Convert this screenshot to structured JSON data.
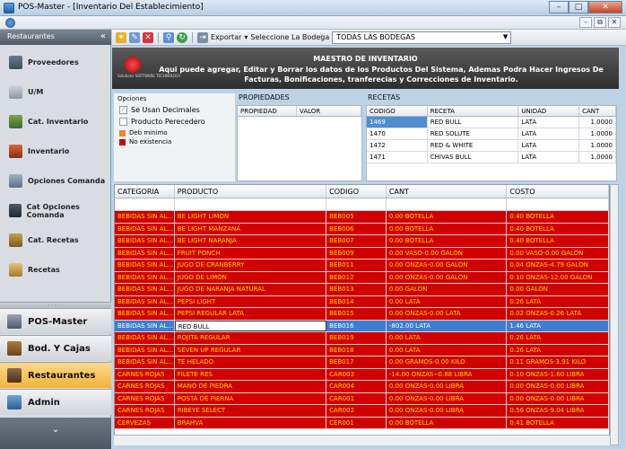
{
  "window": {
    "title": "POS-Master - [Inventario Del Establecimiento]"
  },
  "sidebar": {
    "header": "Restaurantes",
    "collapse": "«",
    "items": [
      {
        "label": "Proveedores",
        "icon": "truck-icon"
      },
      {
        "label": "U/M",
        "icon": "scale-icon"
      },
      {
        "label": "Cat. Inventario",
        "icon": "category-icon"
      },
      {
        "label": "Inventario",
        "icon": "inventory-icon"
      },
      {
        "label": "Opciones Comanda",
        "icon": "options-icon"
      },
      {
        "label": "Cat Opciones Comanda",
        "icon": "catalog-icon"
      },
      {
        "label": "Cat. Recetas",
        "icon": "recipes-cat-icon"
      },
      {
        "label": "Recetas",
        "icon": "recipe-icon"
      }
    ],
    "nav": [
      {
        "label": "POS-Master",
        "icon": "pos-icon",
        "active": false
      },
      {
        "label": "Bod. Y Cajas",
        "icon": "warehouse-icon",
        "active": false
      },
      {
        "label": "Restaurantes",
        "icon": "restaurant-icon",
        "active": true
      },
      {
        "label": "Admin",
        "icon": "admin-icon",
        "active": false
      }
    ],
    "footer": "⌄"
  },
  "toolbar": {
    "export_label": "Exportar",
    "select_label": "Seleccione La Bodega",
    "bodega_value": "TODAS LAS BODEGAS"
  },
  "banner": {
    "title": "MAESTRO DE INVENTARIO",
    "description": "Aqui puede agregar, Editar y Borrar los datos de los Productos Del Sistema, Ademas Podra Hacer Ingresos De Facturas, Bonificaciones, tranferecias y Correcciones de Inventario.",
    "logo_text": "Solutions SOFTWARE TECHNOLOGY"
  },
  "options": {
    "title": "Opciones",
    "chk1": "Se Usan Decimales",
    "chk2": "Producto Perecedero",
    "legend1": "Deb minimo",
    "legend2": "No existencia",
    "colors": {
      "min": "#e8892a",
      "none": "#d10000"
    }
  },
  "propiedades": {
    "title": "PROPIEDADES",
    "headers": [
      "PROPIEDAD",
      "VALOR"
    ]
  },
  "recetas": {
    "title": "RECETAS",
    "headers": [
      "CODIGO",
      "RECETA",
      "UNIDAD",
      "CANT"
    ],
    "rows": [
      [
        "1469",
        "RED BULL",
        "LATA",
        "1.0000"
      ],
      [
        "1470",
        "RED SOLUTE",
        "LATA",
        "1.0000"
      ],
      [
        "1472",
        "RED & WHITE",
        "LATA",
        "1.0000"
      ],
      [
        "1471",
        "CHIVAS BULL",
        "LATA",
        "1.0000"
      ]
    ]
  },
  "main": {
    "headers": [
      "CATEGORIA",
      "PRODUCTO",
      "CODIGO",
      "CANT",
      "COSTO"
    ],
    "rows": [
      [
        "BEBIDAS SIN AL...",
        "BE LIGHT LIMON",
        "BEB005",
        "0.00 BOTELLA",
        "0.40 BOTELLA"
      ],
      [
        "BEBIDAS SIN AL...",
        "BE LIGHT MANZANA",
        "BEB006",
        "0.00 BOTELLA",
        "0.40 BOTELLA"
      ],
      [
        "BEBIDAS SIN AL...",
        "BE LIGHT NARANJA",
        "BEB007",
        "0.00 BOTELLA",
        "0.40 BOTELLA"
      ],
      [
        "BEBIDAS SIN AL...",
        "FRUIT PONCH",
        "BEB009",
        "0.00 VASO-0.00 GALON",
        "0.00 VASO-0.00 GALON"
      ],
      [
        "BEBIDAS SIN AL...",
        "JUGO DE CRANBERRY",
        "BEB011",
        "0.00 ONZAS-0.00 GALON",
        "0.04 ONZAS-4.79 GALON"
      ],
      [
        "BEBIDAS SIN AL...",
        "JUGO DE LIMON",
        "BEB012",
        "0.00 ONZAS-0.00 GALON",
        "0.10 ONZAS-12.00 GALON"
      ],
      [
        "BEBIDAS SIN AL...",
        "JUGO DE NARANJA NATURAL",
        "BEB013",
        "0.00 GALON",
        "0.00 GALON"
      ],
      [
        "BEBIDAS SIN AL...",
        "PEPSI LIGHT",
        "BEB014",
        "0.00 LATA",
        "0.26 LATA"
      ],
      [
        "BEBIDAS SIN AL...",
        "PEPSI REGULAR LATA",
        "BEB015",
        "0.00 ONZAS-0.00 LATA",
        "0.02 ONZAS-0.26 LATA"
      ],
      [
        "BEBIDAS SIN AL...",
        "RED BULL",
        "BEB016",
        "-802.00 LATA",
        "1.46 LATA"
      ],
      [
        "BEBIDAS SIN AL...",
        "ROJITA REGULAR",
        "BEB019",
        "0.00 LATA",
        "0.26 LATA"
      ],
      [
        "BEBIDAS SIN AL...",
        "SEVEN UP REGULAR",
        "BEB018",
        "0.00 LATA",
        "0.26 LATA"
      ],
      [
        "BEBIDAS SIN AL...",
        "TE HELADO",
        "BEB017",
        "0.00 GRAMOS-0.00 KILO",
        "0.11 GRAMOS-3.91 KILO"
      ],
      [
        "CARNES ROJAS",
        "FILETE RES",
        "CAR003",
        "-14.00 ONZAS--0.88 LIBRA",
        "0.10 ONZAS-1.60 LIBRA"
      ],
      [
        "CARNES ROJAS",
        "MANO DE PIEDRA",
        "CAR004",
        "0.00 ONZAS-0.00 LIBRA",
        "0.00 ONZAS-0.00 LIBRA"
      ],
      [
        "CARNES ROJAS",
        "POSTA DE PIERNA",
        "CAR001",
        "0.00 ONZAS-0.00 LIBRA",
        "0.00 ONZAS-0.00 LIBRA"
      ],
      [
        "CARNES ROJAS",
        "RIBEYE SELECT",
        "CAR002",
        "0.00 ONZAS-0.00 LIBRA",
        "0.56 ONZAS-9.04 LIBRA"
      ],
      [
        "CERVEZAS",
        "BRAHVA",
        "CER001",
        "0.00 BOTELLA",
        "0.41 BOTELLA"
      ]
    ],
    "selected_index": 9
  }
}
